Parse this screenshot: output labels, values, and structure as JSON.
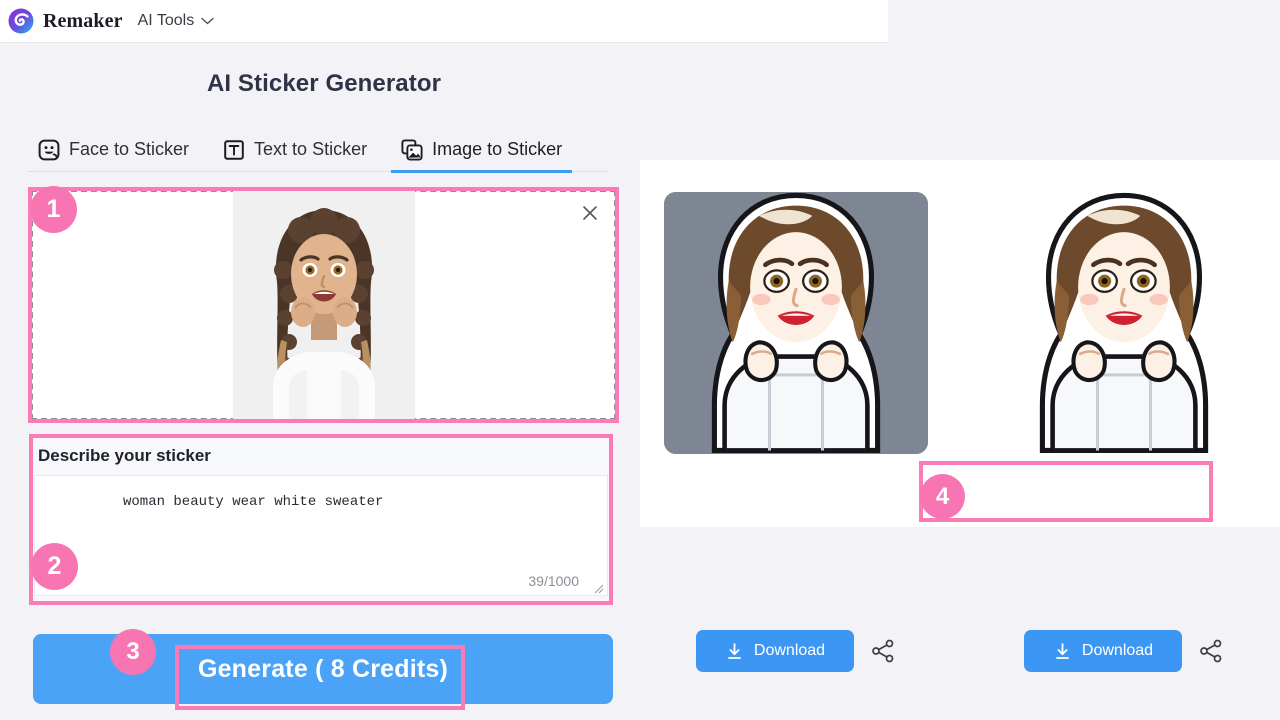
{
  "header": {
    "logo_icon": "remaker-spiral-logo",
    "brand": "Remaker",
    "menu_label": "AI Tools",
    "chevron_icon": "chevron-down-icon"
  },
  "page": {
    "title": "AI Sticker Generator",
    "background_color": "#f3f3f7",
    "accent_color": "#3b97f3",
    "highlight_color": "#fb7bb7"
  },
  "tabs": [
    {
      "label": "Face to Sticker",
      "icon": "smiley-face-icon",
      "active": false
    },
    {
      "label": "Text to Sticker",
      "icon": "text-t-icon",
      "active": false
    },
    {
      "label": "Image to Sticker",
      "icon": "image-stack-icon",
      "active": true
    }
  ],
  "upload": {
    "close_icon": "close-x-icon",
    "image_alt": "uploaded-portrait-woman-curly-hair-white-sweater"
  },
  "describe": {
    "label": "Describe your sticker",
    "value": "woman beauty wear white sweater",
    "placeholder": "Describe your sticker",
    "char_count": "39/1000",
    "resize_icon": "resize-grip-icon"
  },
  "generate": {
    "label": "Generate ( 8 Credits)"
  },
  "results": [
    {
      "name": "sticker-result-1",
      "background": "gray",
      "download_label": "Download",
      "download_icon": "download-icon",
      "share_icon": "share-icon"
    },
    {
      "name": "sticker-result-2",
      "background": "transparent",
      "download_label": "Download",
      "download_icon": "download-icon",
      "share_icon": "share-icon"
    }
  ],
  "badges": {
    "one": "1",
    "two": "2",
    "three": "3",
    "four": "4"
  }
}
